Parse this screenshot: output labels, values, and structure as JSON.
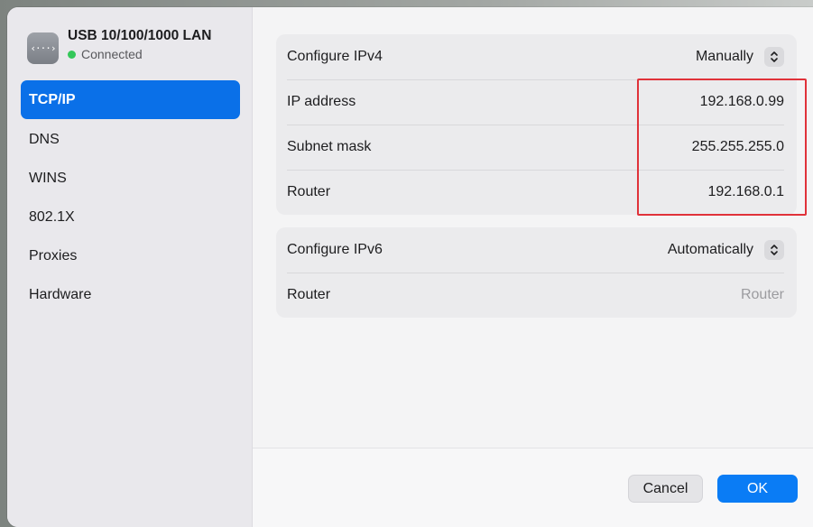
{
  "interface": {
    "icon": "network-interface-icon",
    "icon_glyph": "‹···›",
    "name": "USB 10/100/1000 LAN",
    "status": "Connected",
    "status_color": "#34c759"
  },
  "sidebar": {
    "selected": "TCP/IP",
    "items": [
      {
        "label": "TCP/IP"
      },
      {
        "label": "DNS"
      },
      {
        "label": "WINS"
      },
      {
        "label": "802.1X"
      },
      {
        "label": "Proxies"
      },
      {
        "label": "Hardware"
      }
    ]
  },
  "ipv4": {
    "configure_label": "Configure IPv4",
    "configure_value": "Manually",
    "ip_label": "IP address",
    "ip_value": "192.168.0.99",
    "subnet_label": "Subnet mask",
    "subnet_value": "255.255.255.0",
    "router_label": "Router",
    "router_value": "192.168.0.1"
  },
  "ipv6": {
    "configure_label": "Configure IPv6",
    "configure_value": "Automatically",
    "router_label": "Router",
    "router_placeholder": "Router"
  },
  "footer": {
    "cancel_label": "Cancel",
    "ok_label": "OK"
  },
  "colors": {
    "accent": "#0a7cf5",
    "selection": "#0a70e8",
    "annotation": "#e0323a"
  }
}
